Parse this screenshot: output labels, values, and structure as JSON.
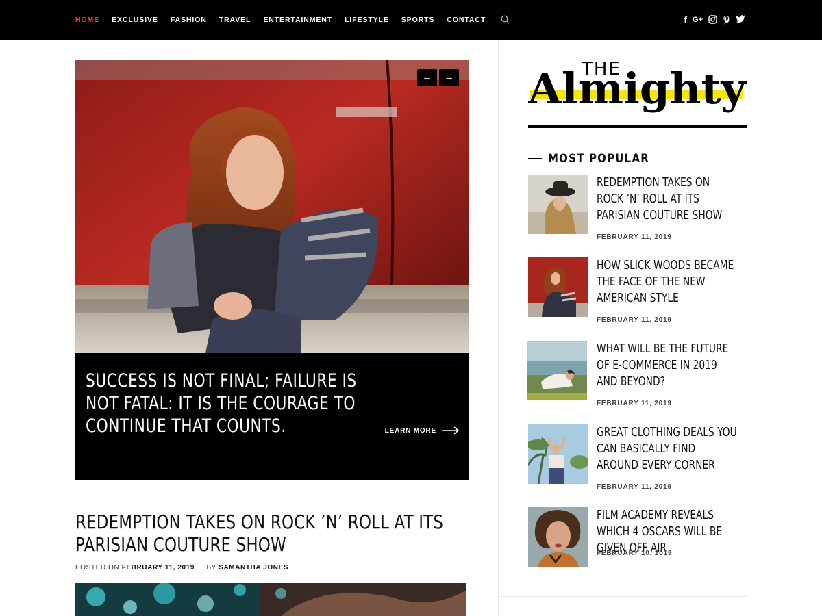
{
  "nav": {
    "items": [
      "HOME",
      "EXCLUSIVE",
      "FASHION",
      "TRAVEL",
      "ENTERTAINMENT",
      "LIFESTYLE",
      "SPORTS",
      "CONTACT"
    ],
    "active_color": "#ff3b3b"
  },
  "social": {
    "icons": [
      "facebook-icon",
      "google-plus-icon",
      "instagram-icon",
      "pinterest-icon",
      "twitter-icon"
    ],
    "facebook": "f",
    "google": "G+"
  },
  "slider": {
    "caption": "SUCCESS IS NOT FINAL; FAILURE IS NOT FATAL: IT IS THE COURAGE TO CONTINUE THAT COUNTS.",
    "learn_more": "LEARN MORE",
    "prev": "←",
    "next": "→",
    "active_dot": 1,
    "dot_count": 3
  },
  "post": {
    "title": "REDEMPTION TAKES ON ROCK ’N’ ROLL AT ITS PARISIAN COUTURE SHOW",
    "posted_on_label": "POSTED ON",
    "date": "FEBRUARY 11, 2019",
    "by_label": "BY",
    "author": "SAMANTHA JONES"
  },
  "sidebar": {
    "logo_the": "THE",
    "logo_name": "Almighty",
    "logo_highlight": "#f5e60a",
    "widget_title": "MOST POPULAR",
    "items": [
      {
        "title": "REDEMPTION TAKES ON ROCK ’N’ ROLL AT ITS PARISIAN COUTURE SHOW",
        "date": "FEBRUARY 11, 2019"
      },
      {
        "title": "HOW SLICK WOODS BECAME THE FACE OF THE NEW AMERICAN STYLE",
        "date": "FEBRUARY 11, 2019"
      },
      {
        "title": "WHAT WILL BE THE FUTURE OF E-COMMERCE IN 2019 AND BEYOND?",
        "date": "FEBRUARY 11, 2019"
      },
      {
        "title": "GREAT CLOTHING DEALS YOU CAN BASICALLY FIND AROUND EVERY CORNER",
        "date": "FEBRUARY 11, 2019"
      },
      {
        "title": "FILM ACADEMY REVEALS WHICH 4 OSCARS WILL BE GIVEN OFF AIR",
        "date": "FEBRUARY 10, 2019"
      }
    ]
  }
}
